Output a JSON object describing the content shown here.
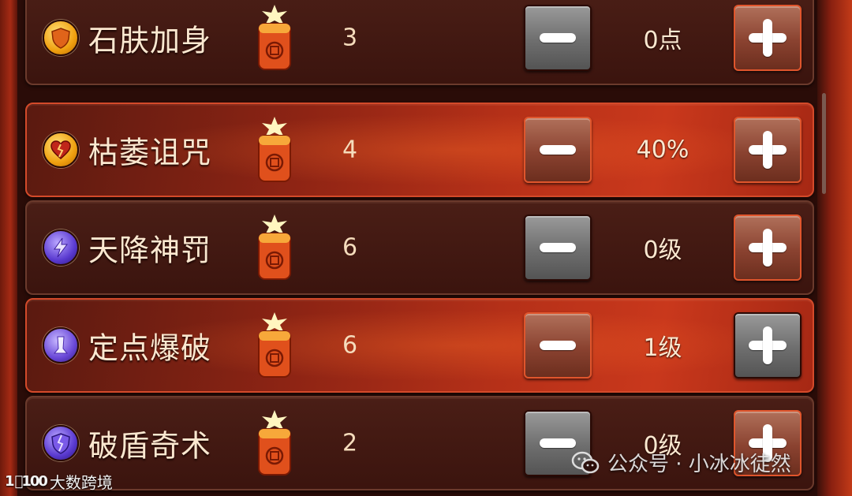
{
  "skills": [
    {
      "name": "石肤加身",
      "icon": "shield-icon",
      "cost": "3",
      "value": "0点",
      "active": false,
      "plus_style": "red"
    },
    {
      "name": "枯萎诅咒",
      "icon": "broken-heart-icon",
      "cost": "4",
      "value": "40%",
      "active": true,
      "plus_style": "red"
    },
    {
      "name": "天降神罚",
      "icon": "lightning-icon",
      "cost": "6",
      "value": "0级",
      "active": false,
      "plus_style": "red"
    },
    {
      "name": "定点爆破",
      "icon": "blast-icon",
      "cost": "6",
      "value": "1级",
      "active": true,
      "plus_style": "grey"
    },
    {
      "name": "破盾奇术",
      "icon": "broken-shield-icon",
      "cost": "2",
      "value": "0级",
      "active": false,
      "plus_style": "red"
    }
  ],
  "watermark_left": "大数跨境",
  "watermark_left_logo": "1⃝100",
  "watermark_right": "公众号 · 小冰冰徒然",
  "colors": {
    "row_bg": "#3b140e",
    "row_active": "#b53018",
    "text": "#fbe8d0",
    "button_grey": "#6e6e6e",
    "button_red": "#8a4230"
  }
}
